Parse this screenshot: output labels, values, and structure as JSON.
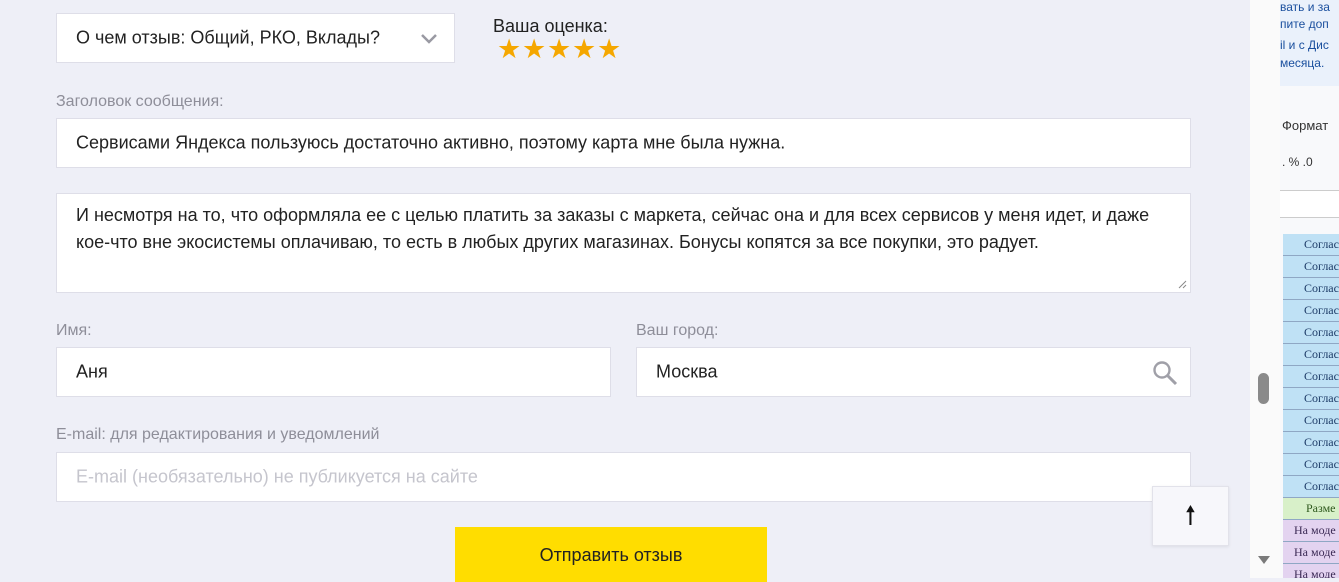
{
  "form": {
    "topic_select": {
      "value": "О чем отзыв: Общий, РКО, Вклады?"
    },
    "rating": {
      "label": "Ваша оценка:",
      "stars": 5,
      "max": 5
    },
    "title_field": {
      "label": "Заголовок сообщения:",
      "value": "Сервисами Яндекса пользуюсь достаточно активно, поэтому карта мне была нужна."
    },
    "message_field": {
      "value": "И несмотря на то, что оформляла ее с целью платить за заказы с маркета, сейчас она и для всех сервисов у меня идет, и даже кое-что вне экосистемы оплачиваю, то есть в любых других магазинах. Бонусы копятся за все покупки, это радует."
    },
    "name_field": {
      "label": "Имя:",
      "value": "Аня"
    },
    "city_field": {
      "label": "Ваш город:",
      "value": "Москва"
    },
    "email_field": {
      "label": "E-mail: для редактирования и уведомлений",
      "placeholder": "E-mail (необязательно) не публикуется на сайте"
    },
    "submit_label": "Отправить отзыв",
    "to_top_glyph": "🠕"
  },
  "side_panel": {
    "lines": [
      "вать и за",
      "пите доп",
      "il и с Дис",
      "месяца."
    ],
    "format_label": "Формат",
    "symbols": ".   %   .0",
    "cells": [
      {
        "text": "Согласо",
        "color": "blue"
      },
      {
        "text": "Согласо",
        "color": "blue"
      },
      {
        "text": "Согласо",
        "color": "blue"
      },
      {
        "text": "Согласо",
        "color": "blue"
      },
      {
        "text": "Согласо",
        "color": "blue"
      },
      {
        "text": "Согласо",
        "color": "blue"
      },
      {
        "text": "Согласо",
        "color": "blue"
      },
      {
        "text": "Согласо",
        "color": "blue"
      },
      {
        "text": "Согласо",
        "color": "blue"
      },
      {
        "text": "Согласо",
        "color": "blue"
      },
      {
        "text": "Согласо",
        "color": "blue"
      },
      {
        "text": "Согласо",
        "color": "blue"
      },
      {
        "text": "Разме",
        "color": "green"
      },
      {
        "text": "На моде",
        "color": "purple"
      },
      {
        "text": "На моде",
        "color": "purple"
      },
      {
        "text": "На моде",
        "color": "purple"
      }
    ]
  }
}
